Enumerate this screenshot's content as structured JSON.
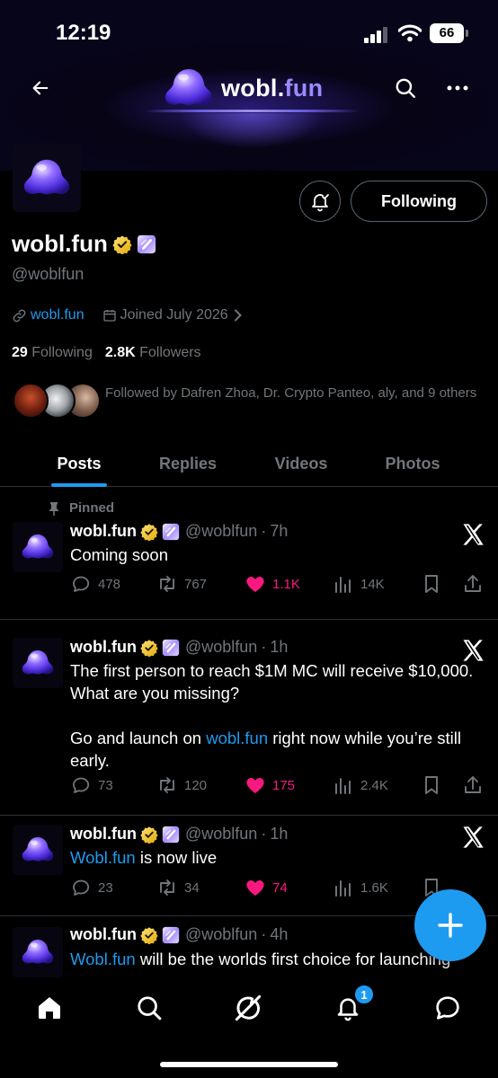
{
  "status_bar": {
    "time": "12:19",
    "battery": "66"
  },
  "banner": {
    "brand_main": "wobl.",
    "brand_accent": "fun"
  },
  "profile": {
    "display_name": "wobl.fun",
    "handle": "@woblfun",
    "website": "wobl.fun",
    "joined": "Joined July 2026",
    "following_count": "29",
    "following_label": "Following",
    "followers_count": "2.8K",
    "followers_label": "Followers",
    "followed_by": "Followed by Dafren Zhoa, Dr. Crypto Panteo, aly, and 9 others",
    "follow_button": "Following"
  },
  "tabs": [
    "Posts",
    "Replies",
    "Videos",
    "Photos"
  ],
  "pinned_label": "Pinned",
  "posts": [
    {
      "name": "wobl.fun",
      "handle": "@woblfun",
      "time": "7h",
      "text": "Coming soon",
      "replies": "478",
      "reposts": "767",
      "likes": "1.1K",
      "views": "14K"
    },
    {
      "name": "wobl.fun",
      "handle": "@woblfun",
      "time": "1h",
      "text_line1": "The first person to reach $1M MC will receive $10,000. What are you missing?",
      "text_pre": "Go and launch on ",
      "text_link": "wobl.fun",
      "text_post": " right now while you’re still early.",
      "replies": "73",
      "reposts": "120",
      "likes": "175",
      "views": "2.4K"
    },
    {
      "name": "wobl.fun",
      "handle": "@woblfun",
      "time": "1h",
      "text_link": "Wobl.fun",
      "text_post": " is now live",
      "replies": "23",
      "reposts": "34",
      "likes": "74",
      "views": "1.6K"
    },
    {
      "name": "wobl.fun",
      "handle": "@woblfun",
      "time": "4h",
      "text_link": "Wobl.fun",
      "text_post": " will be the worlds first choice for launching"
    }
  ],
  "nav": {
    "notifications_badge": "1"
  },
  "colors": {
    "accent": "#1d9bf0",
    "like": "#f91880",
    "muted": "#71767b",
    "verified": "#f4c63d"
  }
}
